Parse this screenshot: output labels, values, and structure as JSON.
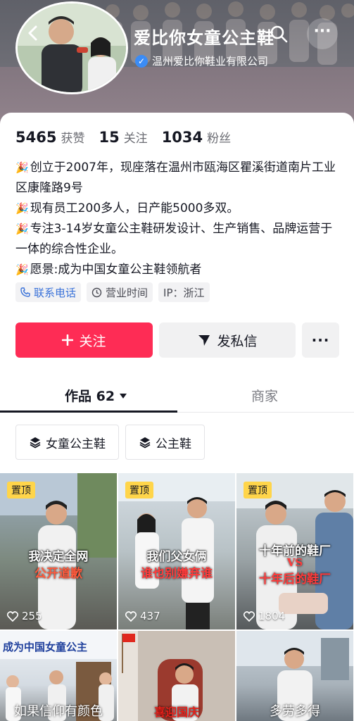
{
  "header": {
    "shop_name": "爱比你女童公主鞋",
    "company": "温州爱比你鞋业有限公司",
    "icons": {
      "back": "back-arrow-icon",
      "search": "search-icon",
      "more": "more-icon",
      "verified": "verified-icon"
    }
  },
  "stats": {
    "likes": {
      "value": "5465",
      "label": "获赞"
    },
    "following": {
      "value": "15",
      "label": "关注"
    },
    "followers": {
      "value": "1034",
      "label": "粉丝"
    }
  },
  "bio": [
    "创立于2007年，现座落在温州市瓯海区瞿溪街道南片工业区康隆路9号",
    "现有员工200多人，日产能5000多双。",
    "专注3-14岁女童公主鞋研发设计、生产销售、品牌运营于一体的综合性企业。",
    "愿景:成为中国女童公主鞋领航者"
  ],
  "tags": {
    "phone": "联系电话",
    "hours": "营业时间",
    "ip": "IP：浙江"
  },
  "actions": {
    "follow": "关注",
    "message": "发私信",
    "more": "···"
  },
  "tabs": {
    "works": "作品 62",
    "shop": "商家"
  },
  "chips": [
    "女童公主鞋",
    "公主鞋"
  ],
  "videos": [
    {
      "pin": "置顶",
      "line1": "我决定全网",
      "line2": "公开道歉",
      "likes": "255"
    },
    {
      "pin": "置顶",
      "line1": "我们父女俩",
      "line2": "谁也别嫌弃谁",
      "likes": "437"
    },
    {
      "pin": "置顶",
      "line1": "十年前的鞋厂",
      "line_vs": "VS",
      "line2": "十年后的鞋厂",
      "likes": "1804"
    },
    {
      "banner": "成为中国女童公主",
      "line1": "如果信仰有颜色"
    },
    {
      "line2": "喜迎国庆"
    },
    {
      "line1": "多劳多得"
    }
  ],
  "colors": {
    "accent": "#fe2c55",
    "pin": "#ffd54a",
    "link": "#3b73d9"
  }
}
